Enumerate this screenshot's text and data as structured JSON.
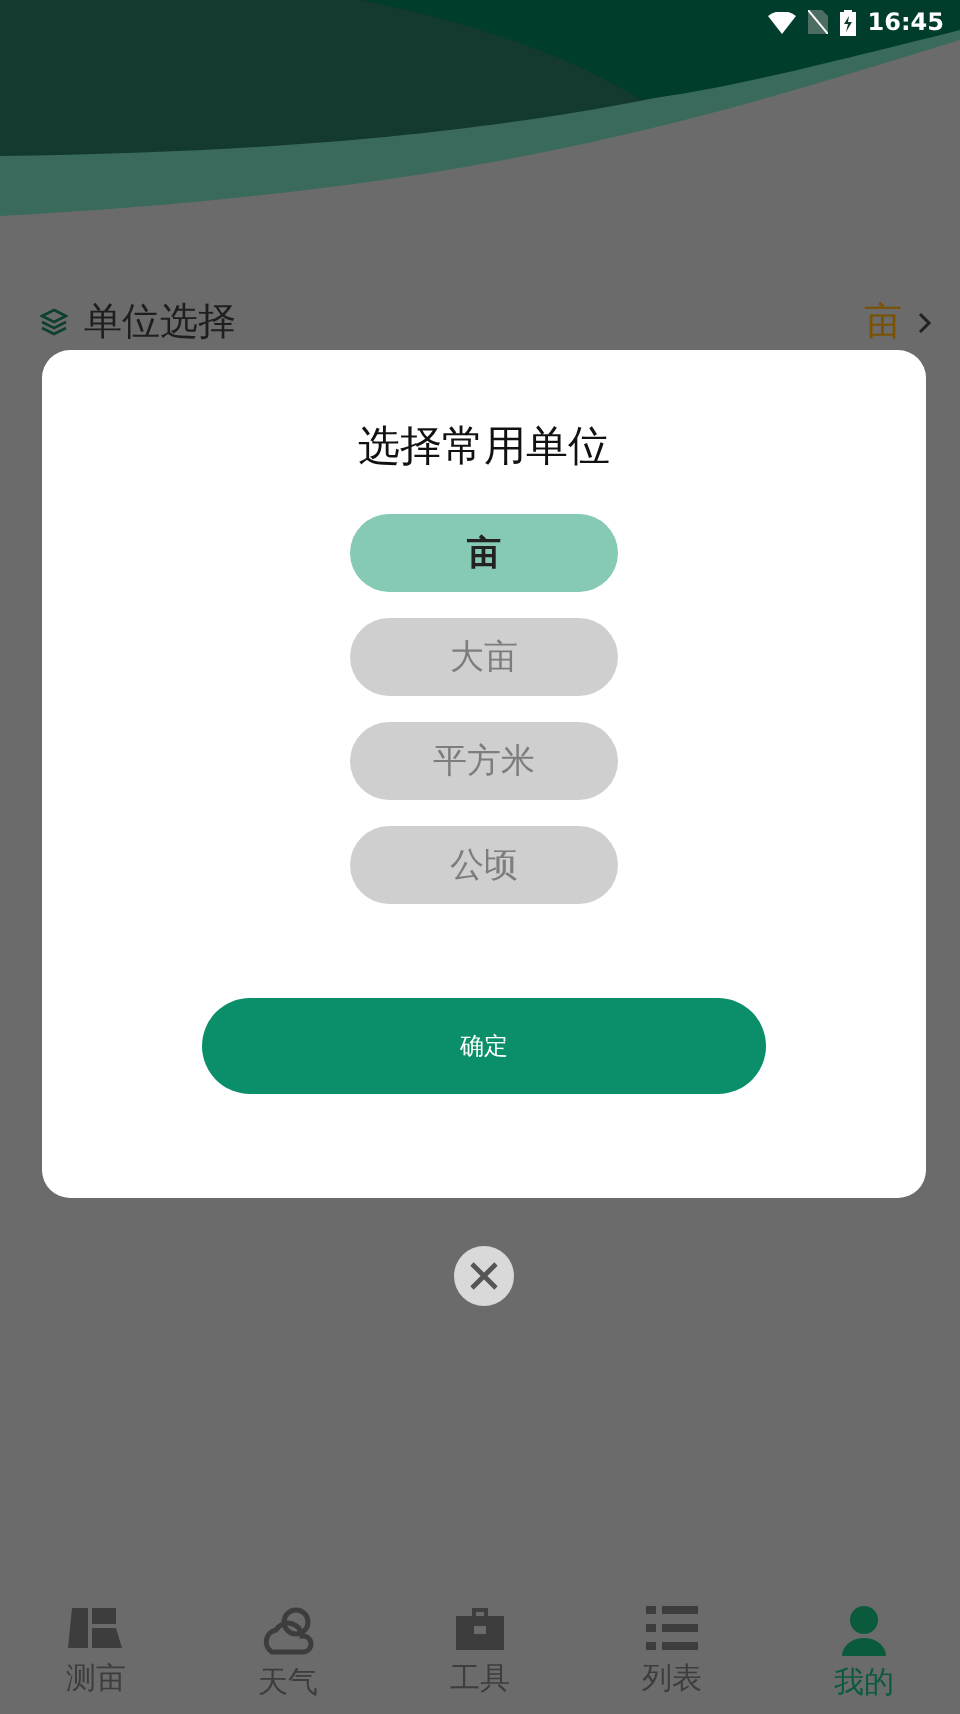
{
  "status_bar": {
    "time": "16:45"
  },
  "unit_row": {
    "label": "单位选择",
    "value": "亩"
  },
  "dialog": {
    "title": "选择常用单位",
    "options": [
      {
        "label": "亩",
        "selected": true
      },
      {
        "label": "大亩",
        "selected": false
      },
      {
        "label": "平方米",
        "selected": false
      },
      {
        "label": "公顷",
        "selected": false
      }
    ],
    "confirm": "确定"
  },
  "nav": [
    {
      "label": "测亩",
      "kind": "measure",
      "selected": false
    },
    {
      "label": "天气",
      "kind": "weather",
      "selected": false
    },
    {
      "label": "工具",
      "kind": "tools",
      "selected": false
    },
    {
      "label": "列表",
      "kind": "list",
      "selected": false
    },
    {
      "label": "我的",
      "kind": "profile",
      "selected": true
    }
  ]
}
